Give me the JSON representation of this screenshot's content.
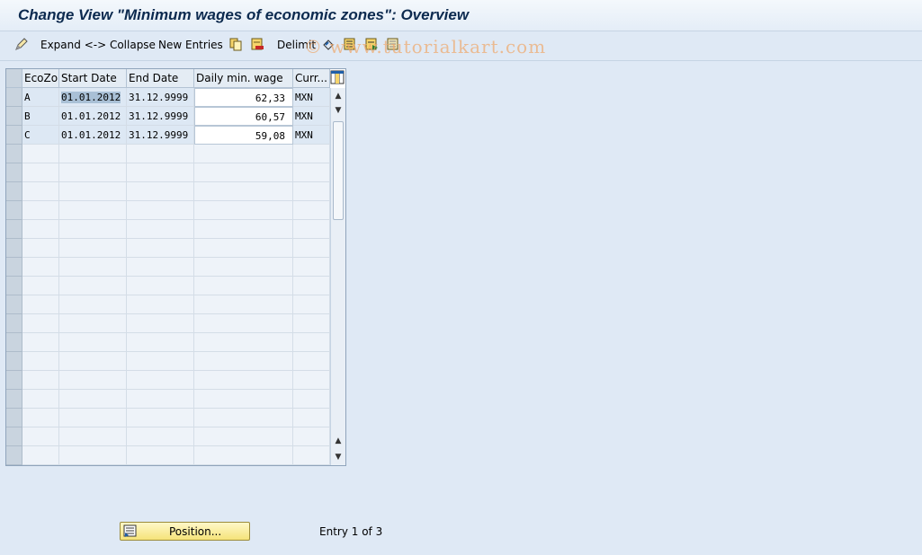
{
  "title": "Change View \"Minimum wages of economic zones\": Overview",
  "toolbar": {
    "expand_collapse": "Expand <-> Collapse",
    "new_entries": "New Entries",
    "delimit": "Delimit"
  },
  "watermark": "© www.tutorialkart.com",
  "table": {
    "headers": [
      "EcoZo",
      "Start Date",
      "End Date",
      "Daily min. wage",
      "Curr..."
    ],
    "rows": [
      {
        "zone": "A",
        "start": "01.01.2012",
        "end": "31.12.9999",
        "wage": "62,33",
        "curr": "MXN"
      },
      {
        "zone": "B",
        "start": "01.01.2012",
        "end": "31.12.9999",
        "wage": "60,57",
        "curr": "MXN"
      },
      {
        "zone": "C",
        "start": "01.01.2012",
        "end": "31.12.9999",
        "wage": "59,08",
        "curr": "MXN"
      }
    ]
  },
  "footer": {
    "position_label": "Position...",
    "entry_text": "Entry 1 of 3"
  },
  "colors": {
    "background": "#dfe9f5",
    "title": "#0c2a4f",
    "button": "#f5e37a"
  }
}
